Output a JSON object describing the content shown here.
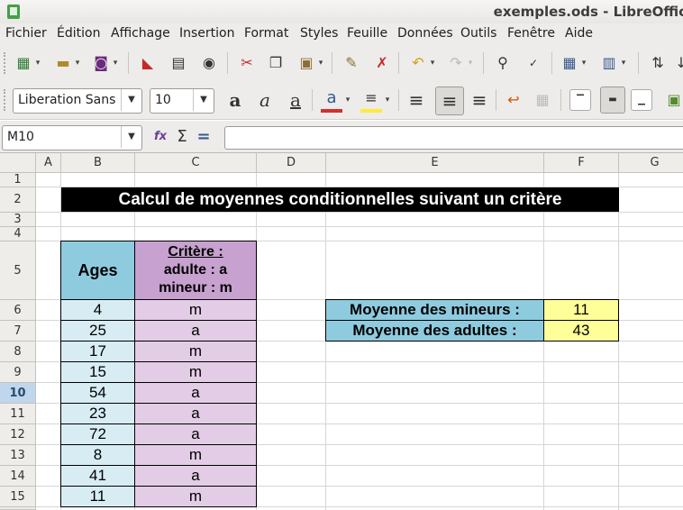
{
  "window": {
    "title": "exemples.ods - LibreOffic"
  },
  "menu": [
    "Fichier",
    "Édition",
    "Affichage",
    "Insertion",
    "Format",
    "Styles",
    "Feuille",
    "Données",
    "Outils",
    "Fenêtre",
    "Aide"
  ],
  "toolbar": {
    "font_name": "Liberation Sans",
    "font_size": "10",
    "underline_glyph": "a"
  },
  "formula_bar": {
    "cell_ref": "M10",
    "fx_label": "fx",
    "sigma": "Σ",
    "equals": "=",
    "formula": ""
  },
  "columns": [
    "A",
    "B",
    "C",
    "D",
    "E",
    "F",
    "G"
  ],
  "rows": [
    "1",
    "2",
    "3",
    "4",
    "5",
    "6",
    "7",
    "8",
    "9",
    "10",
    "11",
    "12",
    "13",
    "14",
    "15"
  ],
  "selected_row": "10",
  "sheet": {
    "title": "Calcul de moyennes conditionnelles suivant un critère",
    "ages_header": "Ages",
    "criteria_header": {
      "line1": "Critère :",
      "line2": "adulte : a",
      "line3": "mineur : m"
    },
    "data": [
      {
        "age": "4",
        "crit": "m"
      },
      {
        "age": "25",
        "crit": "a"
      },
      {
        "age": "17",
        "crit": "m"
      },
      {
        "age": "15",
        "crit": "m"
      },
      {
        "age": "54",
        "crit": "a"
      },
      {
        "age": "23",
        "crit": "a"
      },
      {
        "age": "72",
        "crit": "a"
      },
      {
        "age": "8",
        "crit": "m"
      },
      {
        "age": "41",
        "crit": "a"
      },
      {
        "age": "11",
        "crit": "m"
      }
    ],
    "summary": [
      {
        "label": "Moyenne des mineurs :",
        "value": "11"
      },
      {
        "label": "Moyenne des adultes :",
        "value": "43"
      }
    ]
  },
  "colors": {
    "title_bg": "#000000",
    "ages_header_bg": "#8fcbdf",
    "ages_bg": "#d8ecf3",
    "criteria_header_bg": "#c7a1cf",
    "criteria_bg": "#e3cde6",
    "result_bg": "#ffff99",
    "selected_row_header": "#bfd6ec"
  }
}
